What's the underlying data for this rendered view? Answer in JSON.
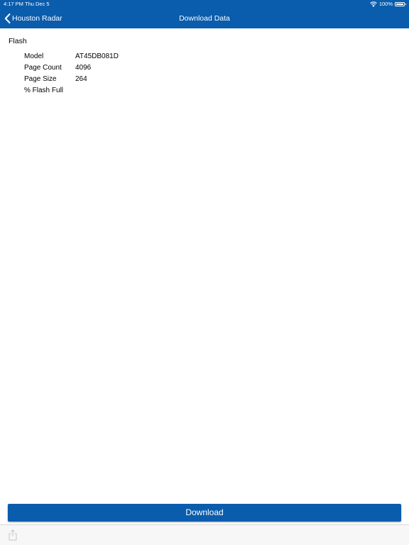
{
  "status_bar": {
    "time": "4:17 PM",
    "date": "Thu Dec 5",
    "battery": "100%",
    "icons": [
      "wifi-icon",
      "battery-icon"
    ]
  },
  "nav": {
    "back_label": "Houston Radar",
    "back_icon": "chevron-left-icon",
    "title": "Download Data"
  },
  "flash": {
    "title": "Flash",
    "rows": [
      {
        "label": "Model",
        "value": "AT45DB081D"
      },
      {
        "label": "Page Count",
        "value": "4096"
      },
      {
        "label": "Page Size",
        "value": "264"
      },
      {
        "label": "% Flash Full",
        "value": ""
      }
    ]
  },
  "download_label": "Download",
  "toolbar": {
    "share_icon": "share-icon"
  },
  "colors": {
    "accent": "#0a5cad",
    "background": "#ffffff",
    "toolbar_background": "#f7f7f7"
  }
}
